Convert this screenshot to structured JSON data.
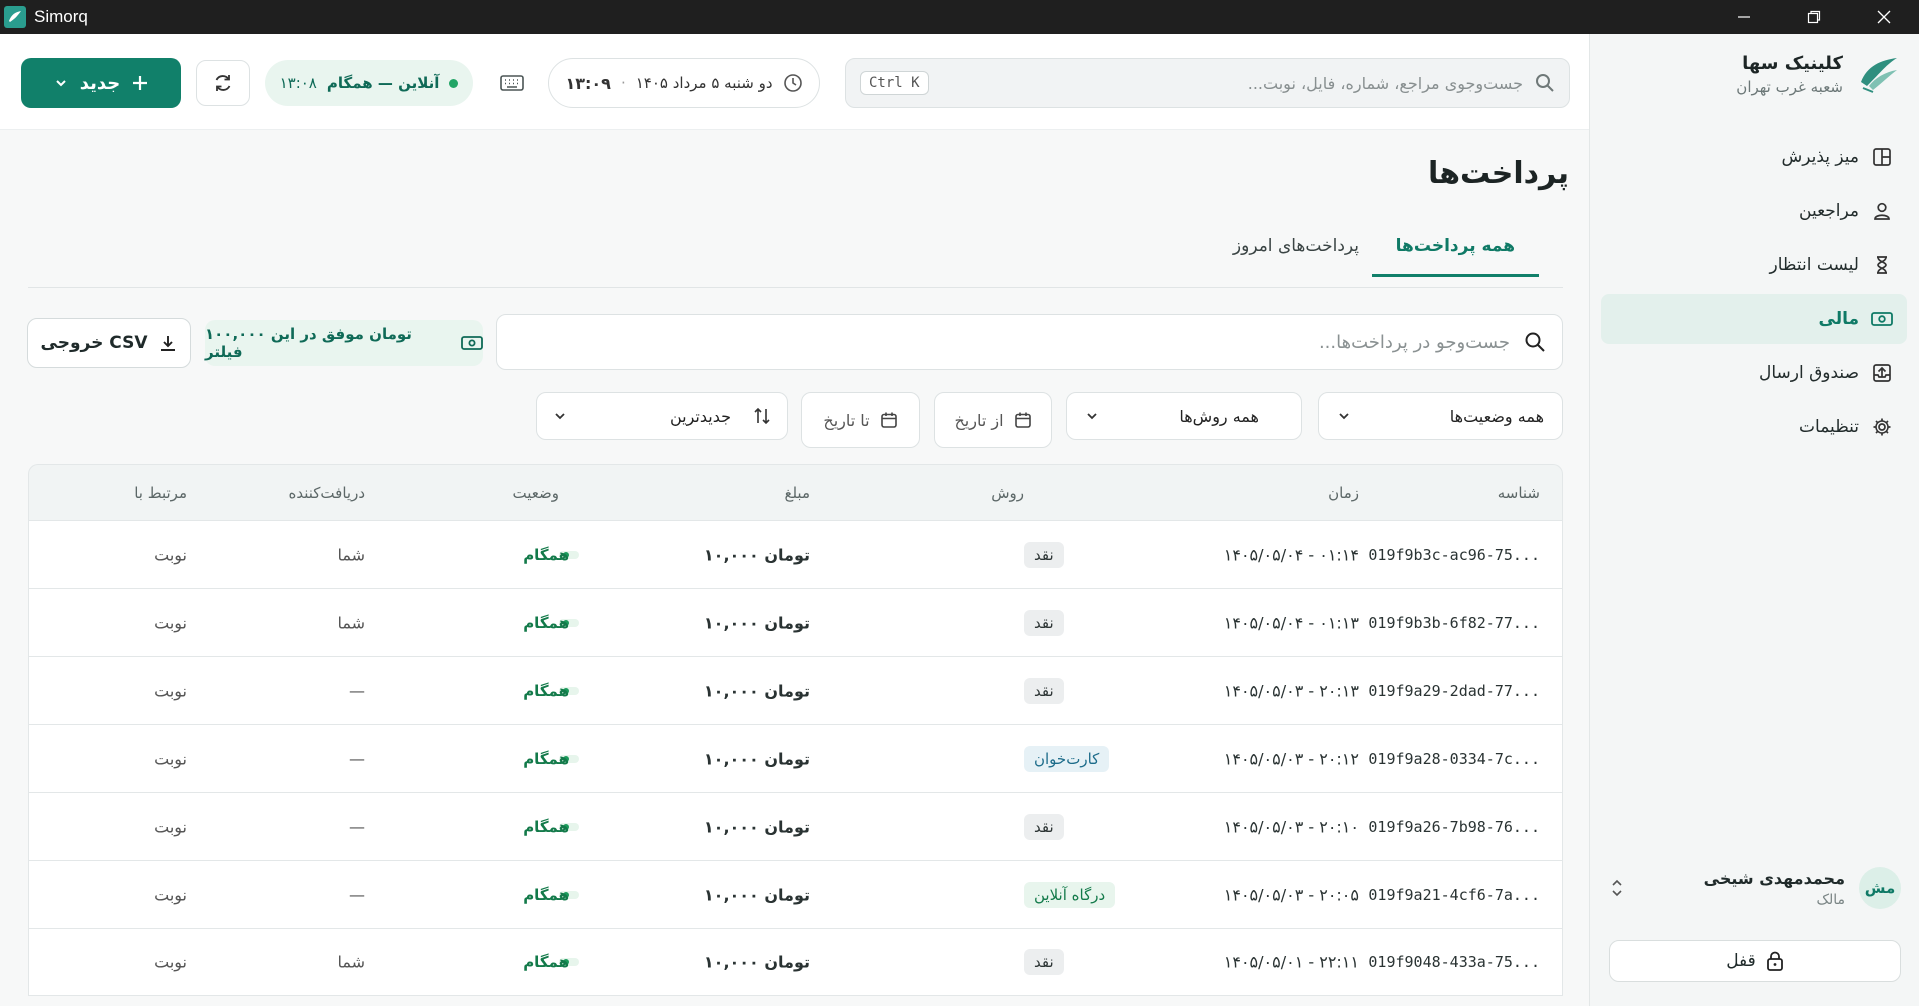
{
  "window": {
    "app_name": "Simorq",
    "controls": [
      "minimize-icon",
      "restore-icon",
      "close-icon"
    ]
  },
  "colors": {
    "accent": "#11806a",
    "accent_light": "#e3f0ec",
    "success": "#22a566",
    "titlebar": "#1f1f1f"
  },
  "sidebar": {
    "brand_title": "کلینیک سها",
    "brand_subtitle": "شعبه غرب تهران",
    "items": [
      {
        "label": "میز پذیرش",
        "icon": "layout-icon",
        "active": false
      },
      {
        "label": "مراجعین",
        "icon": "user-icon",
        "active": false
      },
      {
        "label": "لیست انتظار",
        "icon": "hourglass-icon",
        "active": false
      },
      {
        "label": "مالی",
        "icon": "money-icon",
        "active": true
      },
      {
        "label": "صندوق ارسال",
        "icon": "outbox-icon",
        "active": false
      },
      {
        "label": "تنظیمات",
        "icon": "gear-icon",
        "active": false
      }
    ],
    "user": {
      "initials": "مش",
      "name": "محمدمهدی شیخی",
      "role": "مالک"
    },
    "lock_label": "قفل"
  },
  "header": {
    "search_placeholder": "جست‌وجوی مراجع، شماره، فایل، نوبت...",
    "search_shortcut": "Ctrl K",
    "date": "دو شنبه ۵ مرداد ۱۴۰۵",
    "separator": "·",
    "time": "۱۳:۰۹",
    "status_label": "آنلاین — همگام",
    "status_time": "۱۳:۰۸",
    "new_label": "جدید"
  },
  "main": {
    "title": "پرداخت‌ها",
    "tabs": [
      {
        "label": "همه پرداخت‌ها",
        "active": true
      },
      {
        "label": "پرداخت‌های امروز",
        "active": false
      }
    ],
    "filter_search_placeholder": "جست‌وجو در پرداخت‌ها...",
    "total_text": "۱۰۰,۰۰۰ تومان موفق در این فیلتر",
    "csv_label": "خروجی CSV",
    "status_filter": "همه وضعیت‌ها",
    "method_filter": "همه روش‌ها",
    "from_date": "از تاریخ",
    "to_date": "تا تاریخ",
    "sort_label": "جدیدترین"
  },
  "table": {
    "columns": {
      "id": "شناسه",
      "time": "زمان",
      "method": "روش",
      "amount": "مبلغ",
      "status": "وضعیت",
      "receiver": "دریافت‌کننده",
      "related": "مرتبط با"
    },
    "rows": [
      {
        "id": "019f9b3c-ac96-75...",
        "time": "۱۴۰۵/۰۵/۰۴ - ۰۱:۱۴",
        "method": "نقد",
        "method_type": "cash",
        "amount": "۱۰,۰۰۰ تومان",
        "status": "همگام",
        "receiver": "شما",
        "related": "نوبت"
      },
      {
        "id": "019f9b3b-6f82-77...",
        "time": "۱۴۰۵/۰۵/۰۴ - ۰۱:۱۳",
        "method": "نقد",
        "method_type": "cash",
        "amount": "۱۰,۰۰۰ تومان",
        "status": "همگام",
        "receiver": "شما",
        "related": "نوبت"
      },
      {
        "id": "019f9a29-2dad-77...",
        "time": "۱۴۰۵/۰۵/۰۳ - ۲۰:۱۳",
        "method": "نقد",
        "method_type": "cash",
        "amount": "۱۰,۰۰۰ تومان",
        "status": "همگام",
        "receiver": "—",
        "related": "نوبت"
      },
      {
        "id": "019f9a28-0334-7c...",
        "time": "۱۴۰۵/۰۵/۰۳ - ۲۰:۱۲",
        "method": "کارت‌خوان",
        "method_type": "card",
        "amount": "۱۰,۰۰۰ تومان",
        "status": "همگام",
        "receiver": "—",
        "related": "نوبت"
      },
      {
        "id": "019f9a26-7b98-76...",
        "time": "۱۴۰۵/۰۵/۰۳ - ۲۰:۱۰",
        "method": "نقد",
        "method_type": "cash",
        "amount": "۱۰,۰۰۰ تومان",
        "status": "همگام",
        "receiver": "—",
        "related": "نوبت"
      },
      {
        "id": "019f9a21-4cf6-7a...",
        "time": "۱۴۰۵/۰۵/۰۳ - ۲۰:۰۵",
        "method": "درگاه آنلاین",
        "method_type": "online",
        "amount": "۱۰,۰۰۰ تومان",
        "status": "همگام",
        "receiver": "—",
        "related": "نوبت"
      },
      {
        "id": "019f9048-433a-75...",
        "time": "۱۴۰۵/۰۵/۰۱ - ۲۲:۱۱",
        "method": "نقد",
        "method_type": "cash",
        "amount": "۱۰,۰۰۰ تومان",
        "status": "همگام",
        "receiver": "شما",
        "related": "نوبت"
      }
    ]
  }
}
